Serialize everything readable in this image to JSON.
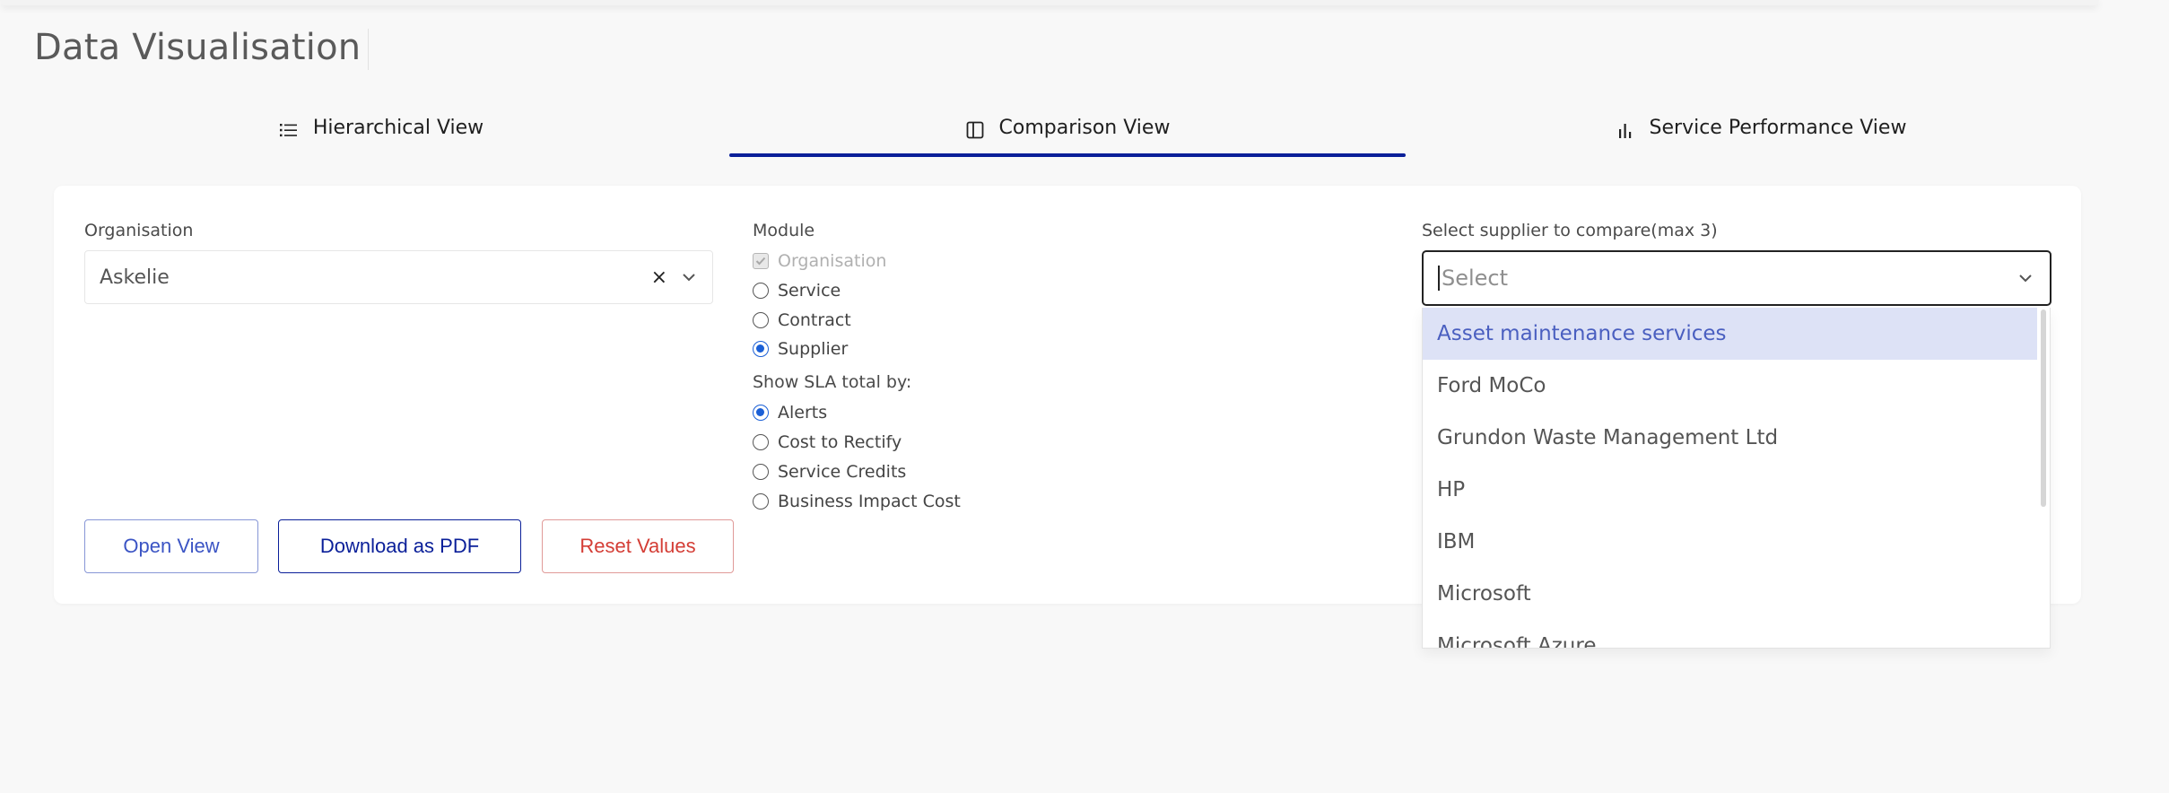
{
  "page": {
    "title": "Data Visualisation"
  },
  "tabs": [
    {
      "label": "Hierarchical View",
      "icon": "list-icon",
      "active": false
    },
    {
      "label": "Comparison View",
      "icon": "columns-icon",
      "active": true
    },
    {
      "label": "Service Performance View",
      "icon": "bar-chart-icon",
      "active": false
    }
  ],
  "organisation": {
    "label": "Organisation",
    "value": "Askelie",
    "clear_symbol": "×"
  },
  "module": {
    "label": "Module",
    "options": [
      {
        "label": "Organisation",
        "type": "checkbox",
        "checked": true,
        "disabled": true
      },
      {
        "label": "Service",
        "type": "radio",
        "checked": false
      },
      {
        "label": "Contract",
        "type": "radio",
        "checked": false
      },
      {
        "label": "Supplier",
        "type": "radio",
        "checked": true
      }
    ]
  },
  "sla": {
    "label": "Show SLA total by:",
    "options": [
      {
        "label": "Alerts",
        "checked": true
      },
      {
        "label": "Cost to Rectify",
        "checked": false
      },
      {
        "label": "Service Credits",
        "checked": false
      },
      {
        "label": "Business Impact Cost",
        "checked": false
      }
    ]
  },
  "buttons": {
    "open": "Open View",
    "pdf": "Download as PDF",
    "reset": "Reset Values"
  },
  "supplier": {
    "label": "Select supplier to compare(max 3)",
    "placeholder": "Select",
    "options": [
      "Asset maintenance services",
      "Ford MoCo",
      "Grundon Waste Management Ltd",
      "HP",
      "IBM",
      "Microsoft",
      "Microsoft Azure"
    ],
    "highlighted_index": 0
  },
  "colors": {
    "accent": "#0a1f99",
    "radio_selected": "#1a5fd6",
    "reset": "#d43d35",
    "highlight": "#dde2f6"
  }
}
